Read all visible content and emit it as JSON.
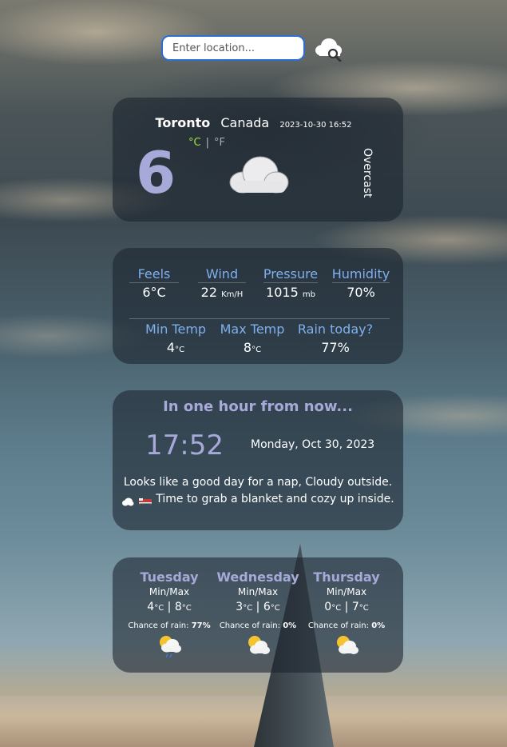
{
  "search": {
    "placeholder": "Enter location..."
  },
  "current": {
    "city": "Toronto",
    "country": "Canada",
    "datetime": "2023-10-30 16:52",
    "unit_c": "°C",
    "unit_sep": "|",
    "unit_f": "°F",
    "temp": "6",
    "condition": "Overcast",
    "icon": "cloud-icon"
  },
  "details": {
    "feels": {
      "label": "Feels",
      "value": "6°C"
    },
    "wind": {
      "label": "Wind",
      "value": "22",
      "unit": "Km/H"
    },
    "pressure": {
      "label": "Pressure",
      "value": "1015",
      "unit": "mb"
    },
    "humidity": {
      "label": "Humidity",
      "value": "70%"
    },
    "min_temp": {
      "label": "Min Temp",
      "value": "4",
      "unit": "°C"
    },
    "max_temp": {
      "label": "Max Temp",
      "value": "8",
      "unit": "°C"
    },
    "rain": {
      "label": "Rain today?",
      "value": "77%"
    }
  },
  "hour": {
    "title": "In one hour from now...",
    "time": "17:52",
    "date": "Monday, Oct 30, 2023",
    "message_1": "Looks like a good day for a nap, Cloudy outside.",
    "message_2": "Time to grab a blanket and cozy up inside."
  },
  "forecast": [
    {
      "day": "Tuesday",
      "minmax_label": "Min/Max",
      "min": "4",
      "max": "8",
      "unit": "°C",
      "rain_label": "Chance of rain:",
      "rain": "77%",
      "icon": "partly-cloudy-rain-icon"
    },
    {
      "day": "Wednesday",
      "minmax_label": "Min/Max",
      "min": "3",
      "max": "6",
      "unit": "°C",
      "rain_label": "Chance of rain:",
      "rain": "0%",
      "icon": "partly-cloudy-icon"
    },
    {
      "day": "Thursday",
      "minmax_label": "Min/Max",
      "min": "0",
      "max": "7",
      "unit": "°C",
      "rain_label": "Chance of rain:",
      "rain": "0%",
      "icon": "partly-cloudy-icon"
    }
  ],
  "colors": {
    "accent": "#a7a9d9",
    "label_blue": "#7fb0ee",
    "celsius_active": "#9ee04a"
  }
}
